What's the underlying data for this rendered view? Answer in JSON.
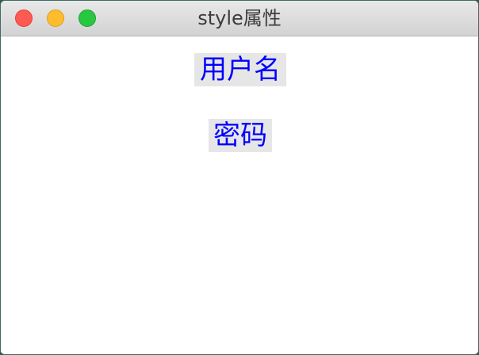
{
  "window": {
    "title": "style属性"
  },
  "labels": {
    "username": "用户名",
    "password": "密码"
  },
  "colors": {
    "label_text": "#0000ff",
    "label_background": "#e6e6e6",
    "close": "#fd5b52",
    "minimize": "#fdbc2e",
    "zoom": "#27c83f"
  }
}
